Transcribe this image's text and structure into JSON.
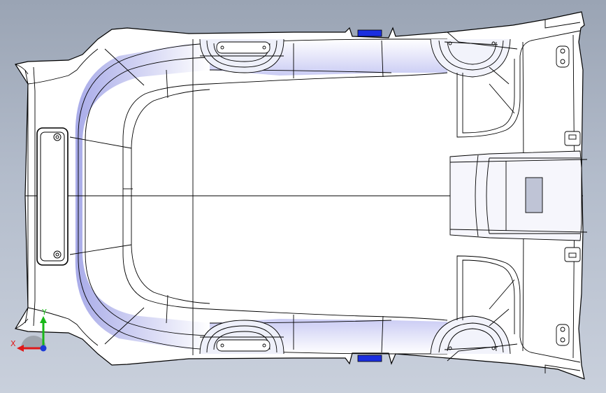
{
  "viewport": {
    "background_top": "#9aa4b4",
    "background_bottom": "#c9d0dc"
  },
  "model": {
    "part": "headliner",
    "view": "top",
    "surface_color": "#ffffff",
    "edge_color": "#000000",
    "shading_color": "#b6b8ee",
    "highlight_color": "#1a2ee0"
  },
  "triad": {
    "x_label": "X",
    "y_label": "Y",
    "x_color": "#e01818",
    "y_color": "#18b818",
    "z_color": "#1a3ad8"
  }
}
